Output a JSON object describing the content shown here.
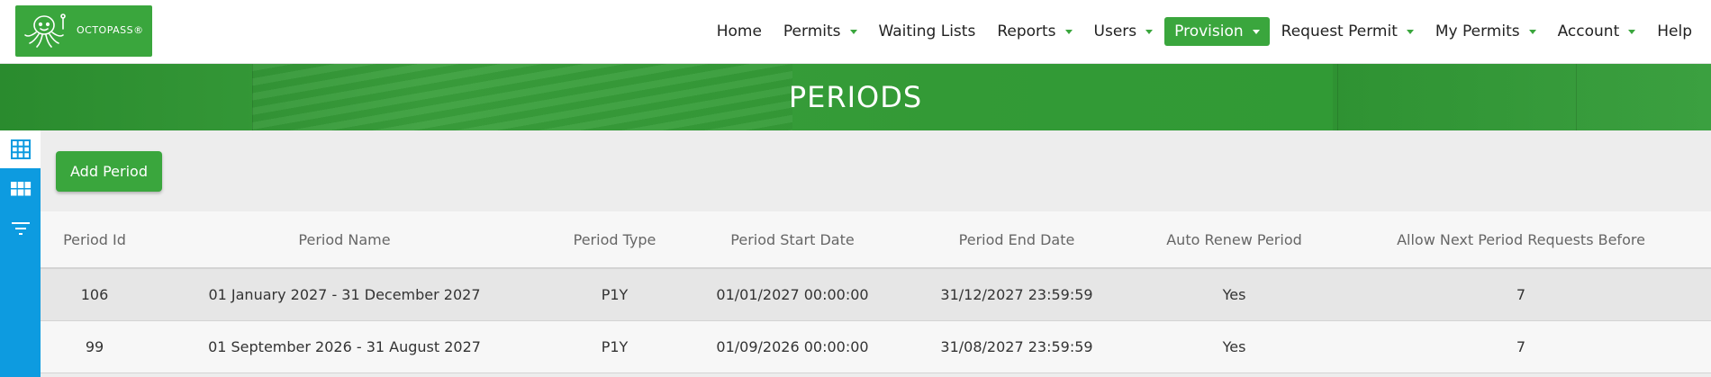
{
  "logo": {
    "brand": "OCTOPASS®"
  },
  "nav": [
    {
      "label": "Home",
      "caret": false,
      "active": false,
      "name": "nav-home"
    },
    {
      "label": "Permits",
      "caret": true,
      "active": false,
      "name": "nav-permits"
    },
    {
      "label": "Waiting Lists",
      "caret": false,
      "active": false,
      "name": "nav-waiting-lists"
    },
    {
      "label": "Reports",
      "caret": true,
      "active": false,
      "name": "nav-reports"
    },
    {
      "label": "Users",
      "caret": true,
      "active": false,
      "name": "nav-users"
    },
    {
      "label": "Provision",
      "caret": true,
      "active": true,
      "name": "nav-provision"
    },
    {
      "label": "Request Permit",
      "caret": true,
      "active": false,
      "name": "nav-request-permit"
    },
    {
      "label": "My Permits",
      "caret": true,
      "active": false,
      "name": "nav-my-permits"
    },
    {
      "label": "Account",
      "caret": true,
      "active": false,
      "name": "nav-account"
    },
    {
      "label": "Help",
      "caret": false,
      "active": false,
      "name": "nav-help"
    }
  ],
  "page": {
    "title": "PERIODS"
  },
  "sidebar": {
    "icons": [
      "grid-icon",
      "tiles-icon",
      "filter-icon"
    ]
  },
  "toolbar": {
    "add_label": "Add Period"
  },
  "table": {
    "columns": [
      "Period Id",
      "Period Name",
      "Period Type",
      "Period Start Date",
      "Period End Date",
      "Auto Renew Period",
      "Allow Next Period Requests Before"
    ],
    "rows": [
      [
        "106",
        "01 January 2027 - 31 December 2027",
        "P1Y",
        "01/01/2027 00:00:00",
        "31/12/2027 23:59:59",
        "Yes",
        "7"
      ],
      [
        "99",
        "01 September 2026 - 31 August 2027",
        "P1Y",
        "01/09/2026 00:00:00",
        "31/08/2027 23:59:59",
        "Yes",
        "7"
      ]
    ]
  },
  "colors": {
    "brand_green": "#3aa63d",
    "sidebar_blue": "#0d9be0"
  }
}
